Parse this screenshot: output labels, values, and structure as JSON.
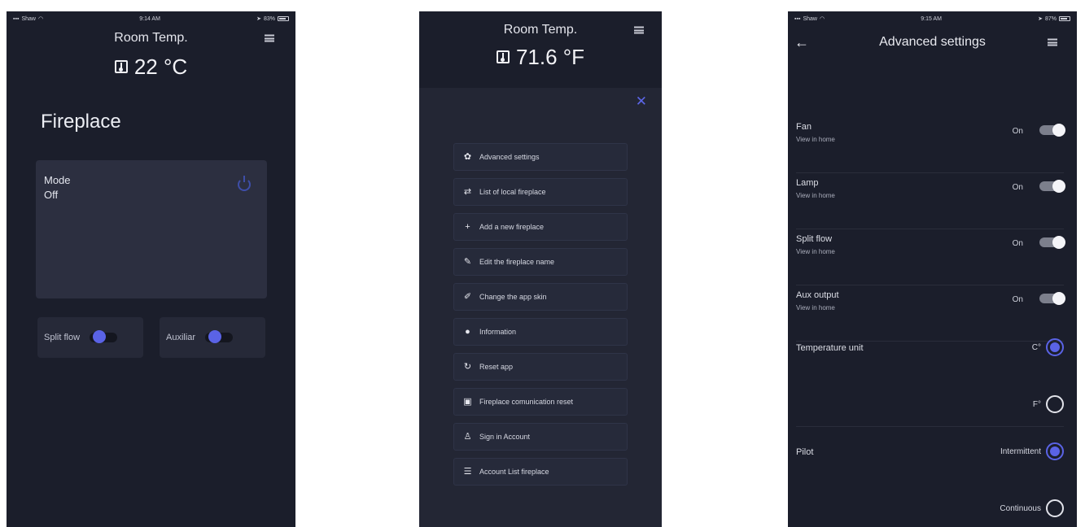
{
  "status_bar_1": {
    "carrier": "Shaw",
    "time": "9:14 AM",
    "battery": "83%"
  },
  "status_bar_3": {
    "carrier": "Shaw",
    "time": "9:15 AM",
    "battery": "87%"
  },
  "screen1": {
    "title": "Room Temp.",
    "temperature": "22 °C",
    "section_title": "Fireplace",
    "mode_label": "Mode",
    "mode_value": "Off",
    "toggles": [
      {
        "label": "Split flow"
      },
      {
        "label": "Auxiliar"
      }
    ]
  },
  "screen2": {
    "title": "Room Temp.",
    "temperature": "71.6 °F",
    "close_glyph": "✕",
    "menu_items": [
      {
        "label": "Advanced settings",
        "icon": "gear-icon",
        "glyph": "✿"
      },
      {
        "label": "List of local fireplace",
        "icon": "swap-icon",
        "glyph": "⇄"
      },
      {
        "label": "Add a new fireplace",
        "icon": "plus-icon",
        "glyph": "+"
      },
      {
        "label": "Edit the fireplace name",
        "icon": "pencil-icon",
        "glyph": "✎"
      },
      {
        "label": "Change the app skin",
        "icon": "brush-icon",
        "glyph": "✐"
      },
      {
        "label": "Information",
        "icon": "info-icon",
        "glyph": "●"
      },
      {
        "label": "Reset app",
        "icon": "reset-icon",
        "glyph": "↻"
      },
      {
        "label": "Fireplace comunication reset",
        "icon": "image-icon",
        "glyph": "▣"
      },
      {
        "label": "Sign in Account",
        "icon": "user-icon",
        "glyph": "♙"
      },
      {
        "label": "Account List fireplace",
        "icon": "list-icon",
        "glyph": "☰"
      }
    ]
  },
  "screen3": {
    "title": "Advanced settings",
    "back_glyph": "←",
    "settings": [
      {
        "title": "Fan",
        "subtitle": "View in home",
        "state": "On"
      },
      {
        "title": "Lamp",
        "subtitle": "View in home",
        "state": "On"
      },
      {
        "title": "Split flow",
        "subtitle": "View in home",
        "state": "On"
      },
      {
        "title": "Aux output",
        "subtitle": "View in home",
        "state": "On"
      }
    ],
    "temperature_unit": {
      "title": "Temperature unit",
      "options": [
        {
          "label": "C°",
          "checked": true
        },
        {
          "label": "F°",
          "checked": false
        }
      ]
    },
    "pilot": {
      "title": "Pilot",
      "options": [
        {
          "label": "Intermittent",
          "checked": true
        },
        {
          "label": "Continuous",
          "checked": false
        }
      ]
    }
  },
  "colors": {
    "accent": "#5a63e6",
    "background": "#1b1e2b",
    "card": "#2c2f40"
  }
}
